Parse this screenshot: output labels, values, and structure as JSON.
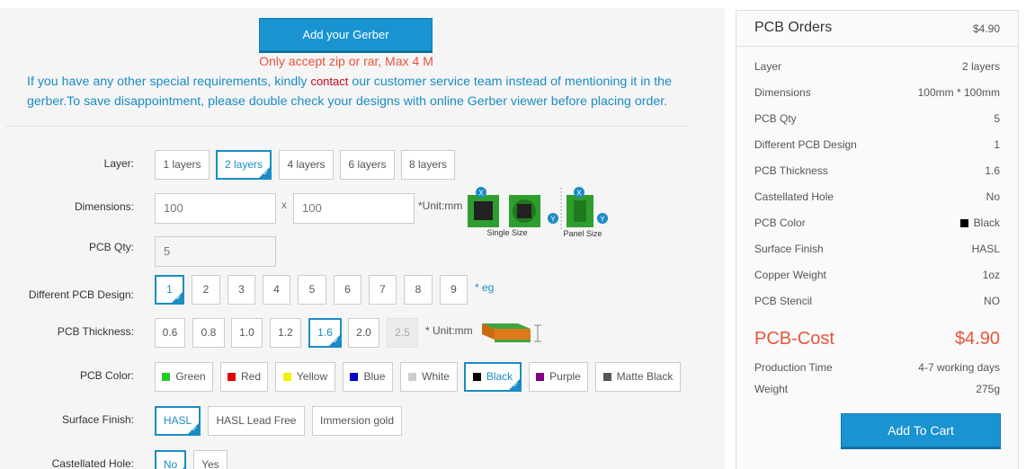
{
  "upload": {
    "button_label": "Add your Gerber",
    "note": "Only accept zip or rar, Max 4 M",
    "info_before": "If you have any other special requirements, kindly ",
    "info_link": "contact",
    "info_after": " our customer service team instead of mentioning it in the gerber.To save disappointment, please double check your designs with online Gerber viewer before placing order."
  },
  "form": {
    "layer": {
      "label": "Layer:",
      "options": [
        "1 layers",
        "2 layers",
        "4 layers",
        "6 layers",
        "8 layers"
      ],
      "selected": "2 layers"
    },
    "dimensions": {
      "label": "Dimensions:",
      "x_value": "100",
      "y_value": "100",
      "separator": "x",
      "unit": "*Unit:mm",
      "single_caption": "Single Size",
      "panel_caption": "Panel Size",
      "x_marker": "X",
      "y_marker": "Y"
    },
    "qty": {
      "label": "PCB Qty:",
      "value": "5"
    },
    "designs": {
      "label": "Different PCB Design:",
      "options": [
        "1",
        "2",
        "3",
        "4",
        "5",
        "6",
        "7",
        "8",
        "9"
      ],
      "selected": "1",
      "eg": "* eg"
    },
    "thickness": {
      "label": "PCB Thickness:",
      "options": [
        "0.6",
        "0.8",
        "1.0",
        "1.2",
        "1.6",
        "2.0",
        "2.5"
      ],
      "selected": "1.6",
      "disabled": "2.5",
      "unit": "* Unit:mm"
    },
    "color": {
      "label": "PCB Color:",
      "options": [
        {
          "name": "Green",
          "swatch": "#22cc22"
        },
        {
          "name": "Red",
          "swatch": "#e00000"
        },
        {
          "name": "Yellow",
          "swatch": "#f2f200"
        },
        {
          "name": "Blue",
          "swatch": "#0000cc"
        },
        {
          "name": "White",
          "swatch": "#cccccc"
        },
        {
          "name": "Black",
          "swatch": "#000000"
        },
        {
          "name": "Purple",
          "swatch": "#800080"
        },
        {
          "name": "Matte Black",
          "swatch": "#555555"
        }
      ],
      "selected": "Black"
    },
    "finish": {
      "label": "Surface Finish:",
      "options": [
        "HASL",
        "HASL Lead Free",
        "Immersion gold"
      ],
      "selected": "HASL"
    },
    "castellated": {
      "label": "Castellated Hole:",
      "options": [
        "No",
        "Yes"
      ],
      "selected": "No"
    }
  },
  "summary": {
    "title": "PCB Orders",
    "price": "$4.90",
    "rows": [
      {
        "key": "Layer",
        "value": "2 layers"
      },
      {
        "key": "Dimensions",
        "value": "100mm * 100mm"
      },
      {
        "key": "PCB Qty",
        "value": "5"
      },
      {
        "key": "Different PCB Design",
        "value": "1"
      },
      {
        "key": "PCB Thickness",
        "value": "1.6"
      },
      {
        "key": "Castellated Hole",
        "value": "No"
      },
      {
        "key": "PCB Color",
        "value": "Black"
      },
      {
        "key": "Surface Finish",
        "value": "HASL"
      },
      {
        "key": "Copper Weight",
        "value": "1oz"
      },
      {
        "key": "PCB Stencil",
        "value": "NO"
      }
    ],
    "cost_label": "PCB-Cost",
    "cost_value": "$4.90",
    "production_label": "Production Time",
    "production_value": "4-7 working days",
    "weight_label": "Weight",
    "weight_value": "275g",
    "cart_label": "Add To Cart"
  },
  "colors": {
    "accent": "#1a8cc4",
    "button": "#1a93d1",
    "warning": "#e8553b"
  }
}
